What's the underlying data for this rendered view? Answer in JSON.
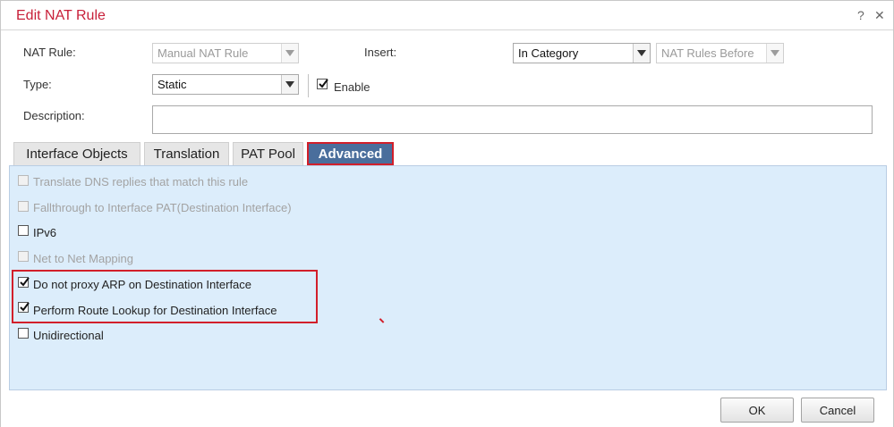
{
  "dialog": {
    "title": "Edit NAT Rule",
    "help_glyph": "?",
    "close_glyph": "✕"
  },
  "form": {
    "nat_rule_label": "NAT Rule:",
    "nat_rule_value": "Manual NAT Rule",
    "insert_label": "Insert:",
    "insert_value": "In Category",
    "insert_position_value": "NAT Rules Before",
    "type_label": "Type:",
    "type_value": "Static",
    "enable_label": "Enable",
    "description_label": "Description:",
    "description_value": ""
  },
  "tabs": [
    {
      "label": "Interface Objects"
    },
    {
      "label": "Translation"
    },
    {
      "label": "PAT Pool"
    },
    {
      "label": "Advanced"
    }
  ],
  "advanced_options": [
    {
      "label": "Translate DNS replies that match this rule",
      "checked": false,
      "disabled": true
    },
    {
      "label": "Fallthrough to Interface PAT(Destination Interface)",
      "checked": false,
      "disabled": true
    },
    {
      "label": "IPv6",
      "checked": false,
      "disabled": false
    },
    {
      "label": "Net to Net Mapping",
      "checked": false,
      "disabled": true
    },
    {
      "label": "Do not proxy ARP on Destination Interface",
      "checked": true,
      "disabled": false
    },
    {
      "label": "Perform Route Lookup for Destination Interface",
      "checked": true,
      "disabled": false
    },
    {
      "label": "Unidirectional",
      "checked": false,
      "disabled": false
    }
  ],
  "buttons": {
    "ok_label": "OK",
    "cancel_label": "Cancel"
  },
  "colors": {
    "title": "#c8203a",
    "active_tab": "#4a6e9c",
    "panel": "#dcedfb",
    "highlight": "#d21f2a"
  }
}
